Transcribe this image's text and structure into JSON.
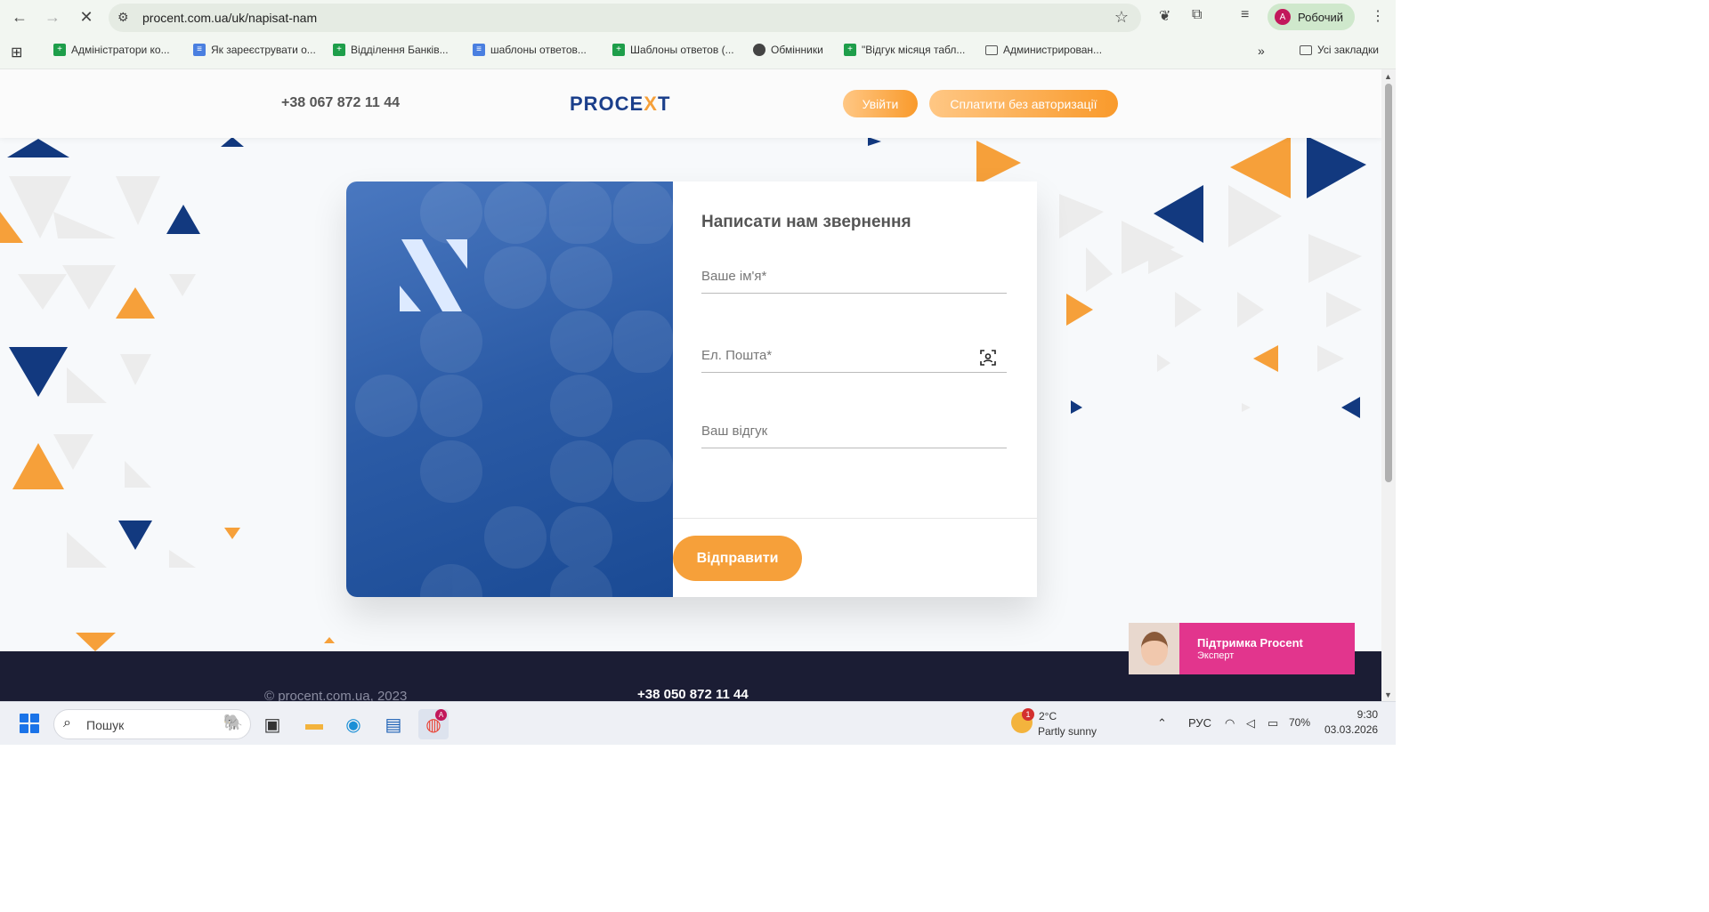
{
  "browser": {
    "url": "procent.com.ua/uk/napisat-nam",
    "profile_initial": "A",
    "profile_label": "Робочий",
    "bookmarks": [
      "Адміністратори ко...",
      "Як зареєструвати о...",
      "Відділення Банків...",
      "шаблоны ответов...",
      "Шаблоны ответов (...",
      "Обмінники",
      "\"Відгук місяця табл...",
      "Администрирован..."
    ],
    "bookmarks_overflow": "»",
    "all_bookmarks": "Усі закладки"
  },
  "header": {
    "phone": "+38 067 872 11 44",
    "logo_left": "PROCE",
    "logo_x": "X",
    "logo_right": "T",
    "login_label": "Увійти",
    "pay_label": "Сплатити без авторизації"
  },
  "form": {
    "title": "Написати нам звернення",
    "name_placeholder": "Ваше ім'я*",
    "email_placeholder": "Ел. Пошта*",
    "feedback_placeholder": "Ваш відгук",
    "submit_label": "Відправити"
  },
  "footer": {
    "copyright": "© procent.com.ua, 2023",
    "phone": "+38 050 872 11 44"
  },
  "support_widget": {
    "title": "Підтримка Procent",
    "subtitle": "Эксперт"
  },
  "taskbar": {
    "search_placeholder": "Пошук",
    "weather_temp": "2°C",
    "weather_desc": "Partly sunny",
    "weather_badge": "1",
    "chrome_badge": "A",
    "language": "РУС",
    "battery": "70%",
    "time": "9:30",
    "date": "03.03.2026"
  },
  "colors": {
    "brand_blue": "#1b3f8b",
    "brand_orange": "#f6a03a",
    "support_pink": "#e2358d"
  }
}
